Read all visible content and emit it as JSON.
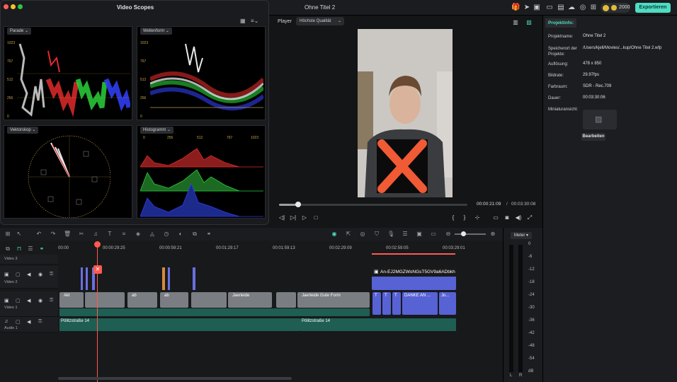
{
  "topbar": {
    "doc_title": "Ohne Titel 2",
    "credits": "2000",
    "export_label": "Exportieren"
  },
  "scopes": {
    "title": "Video Scopes",
    "parade": {
      "label": "Parade",
      "ticks": [
        "1023",
        "767",
        "512",
        "256",
        "0"
      ]
    },
    "waveform": {
      "label": "Wellenform",
      "ticks": [
        "1023",
        "767",
        "512",
        "256",
        "0"
      ]
    },
    "vectorscope": {
      "label": "Vektorskop"
    },
    "histogram": {
      "label": "Histogramm",
      "ticks": [
        "0",
        "256",
        "512",
        "767",
        "1023"
      ]
    }
  },
  "player": {
    "label": "Player",
    "quality": "Höchste Qualität",
    "progress": 0.1,
    "current_time": "00:00:21:09",
    "separator": "/",
    "total_time": "00:03:30:08"
  },
  "project_info": {
    "tab": "Projektinfo:",
    "rows": [
      {
        "k": "Projektname:",
        "v": "Ohne Titel 2"
      },
      {
        "k": "Speicherort der Projekte:",
        "v": "/Users/kjell/Movies/...kup/Ohne Titel 2.wfp"
      },
      {
        "k": "Auflösung:",
        "v": "478 x 850"
      },
      {
        "k": "Bildrate:",
        "v": "29.97fps"
      },
      {
        "k": "Farbraum:",
        "v": "SDR - Rec.709"
      },
      {
        "k": "Dauer:",
        "v": "00:03:30:06"
      },
      {
        "k": "Miniaturansicht:",
        "v": ""
      }
    ],
    "edit_label": "Bearbeiten"
  },
  "timeline": {
    "ruler": [
      "00:00",
      "00:00:29:25",
      "00:00:59:21",
      "00:01:29:17",
      "00:01:59:13",
      "00:02:29:09",
      "00:02:59:05",
      "00:03:29:01"
    ],
    "tracks": {
      "video3": "Video 3",
      "video2": "Video 2",
      "video1": "Video 1",
      "audio1": "Audio 1"
    },
    "video1_clips": [
      "Akt",
      "ab",
      "ab",
      "Jaerleide",
      "Jaerleide",
      "Jaerleide Gute Form",
      "Jaerleide Gute Form"
    ],
    "title_clip": "An-EJ2MGZWoNGsT5GV9a6ADbkh",
    "text_clips": [
      "T",
      "T",
      "T",
      "DANKE AN ...",
      "Jo..."
    ],
    "audio_clips": [
      "Pölitzstraße 14",
      "Pölitzstraße 14"
    ]
  },
  "meter": {
    "title": "Meter",
    "db_labels": [
      "0",
      "-6",
      "-12",
      "-18",
      "-24",
      "-30",
      "-36",
      "-42",
      "-48",
      "-54",
      "dB"
    ],
    "left": "L",
    "right": "R"
  },
  "colors": {
    "accent": "#4fdcc3",
    "playhead": "#ff5a4f",
    "title_clip": "#5762d5",
    "audio": "#1f5e53"
  }
}
